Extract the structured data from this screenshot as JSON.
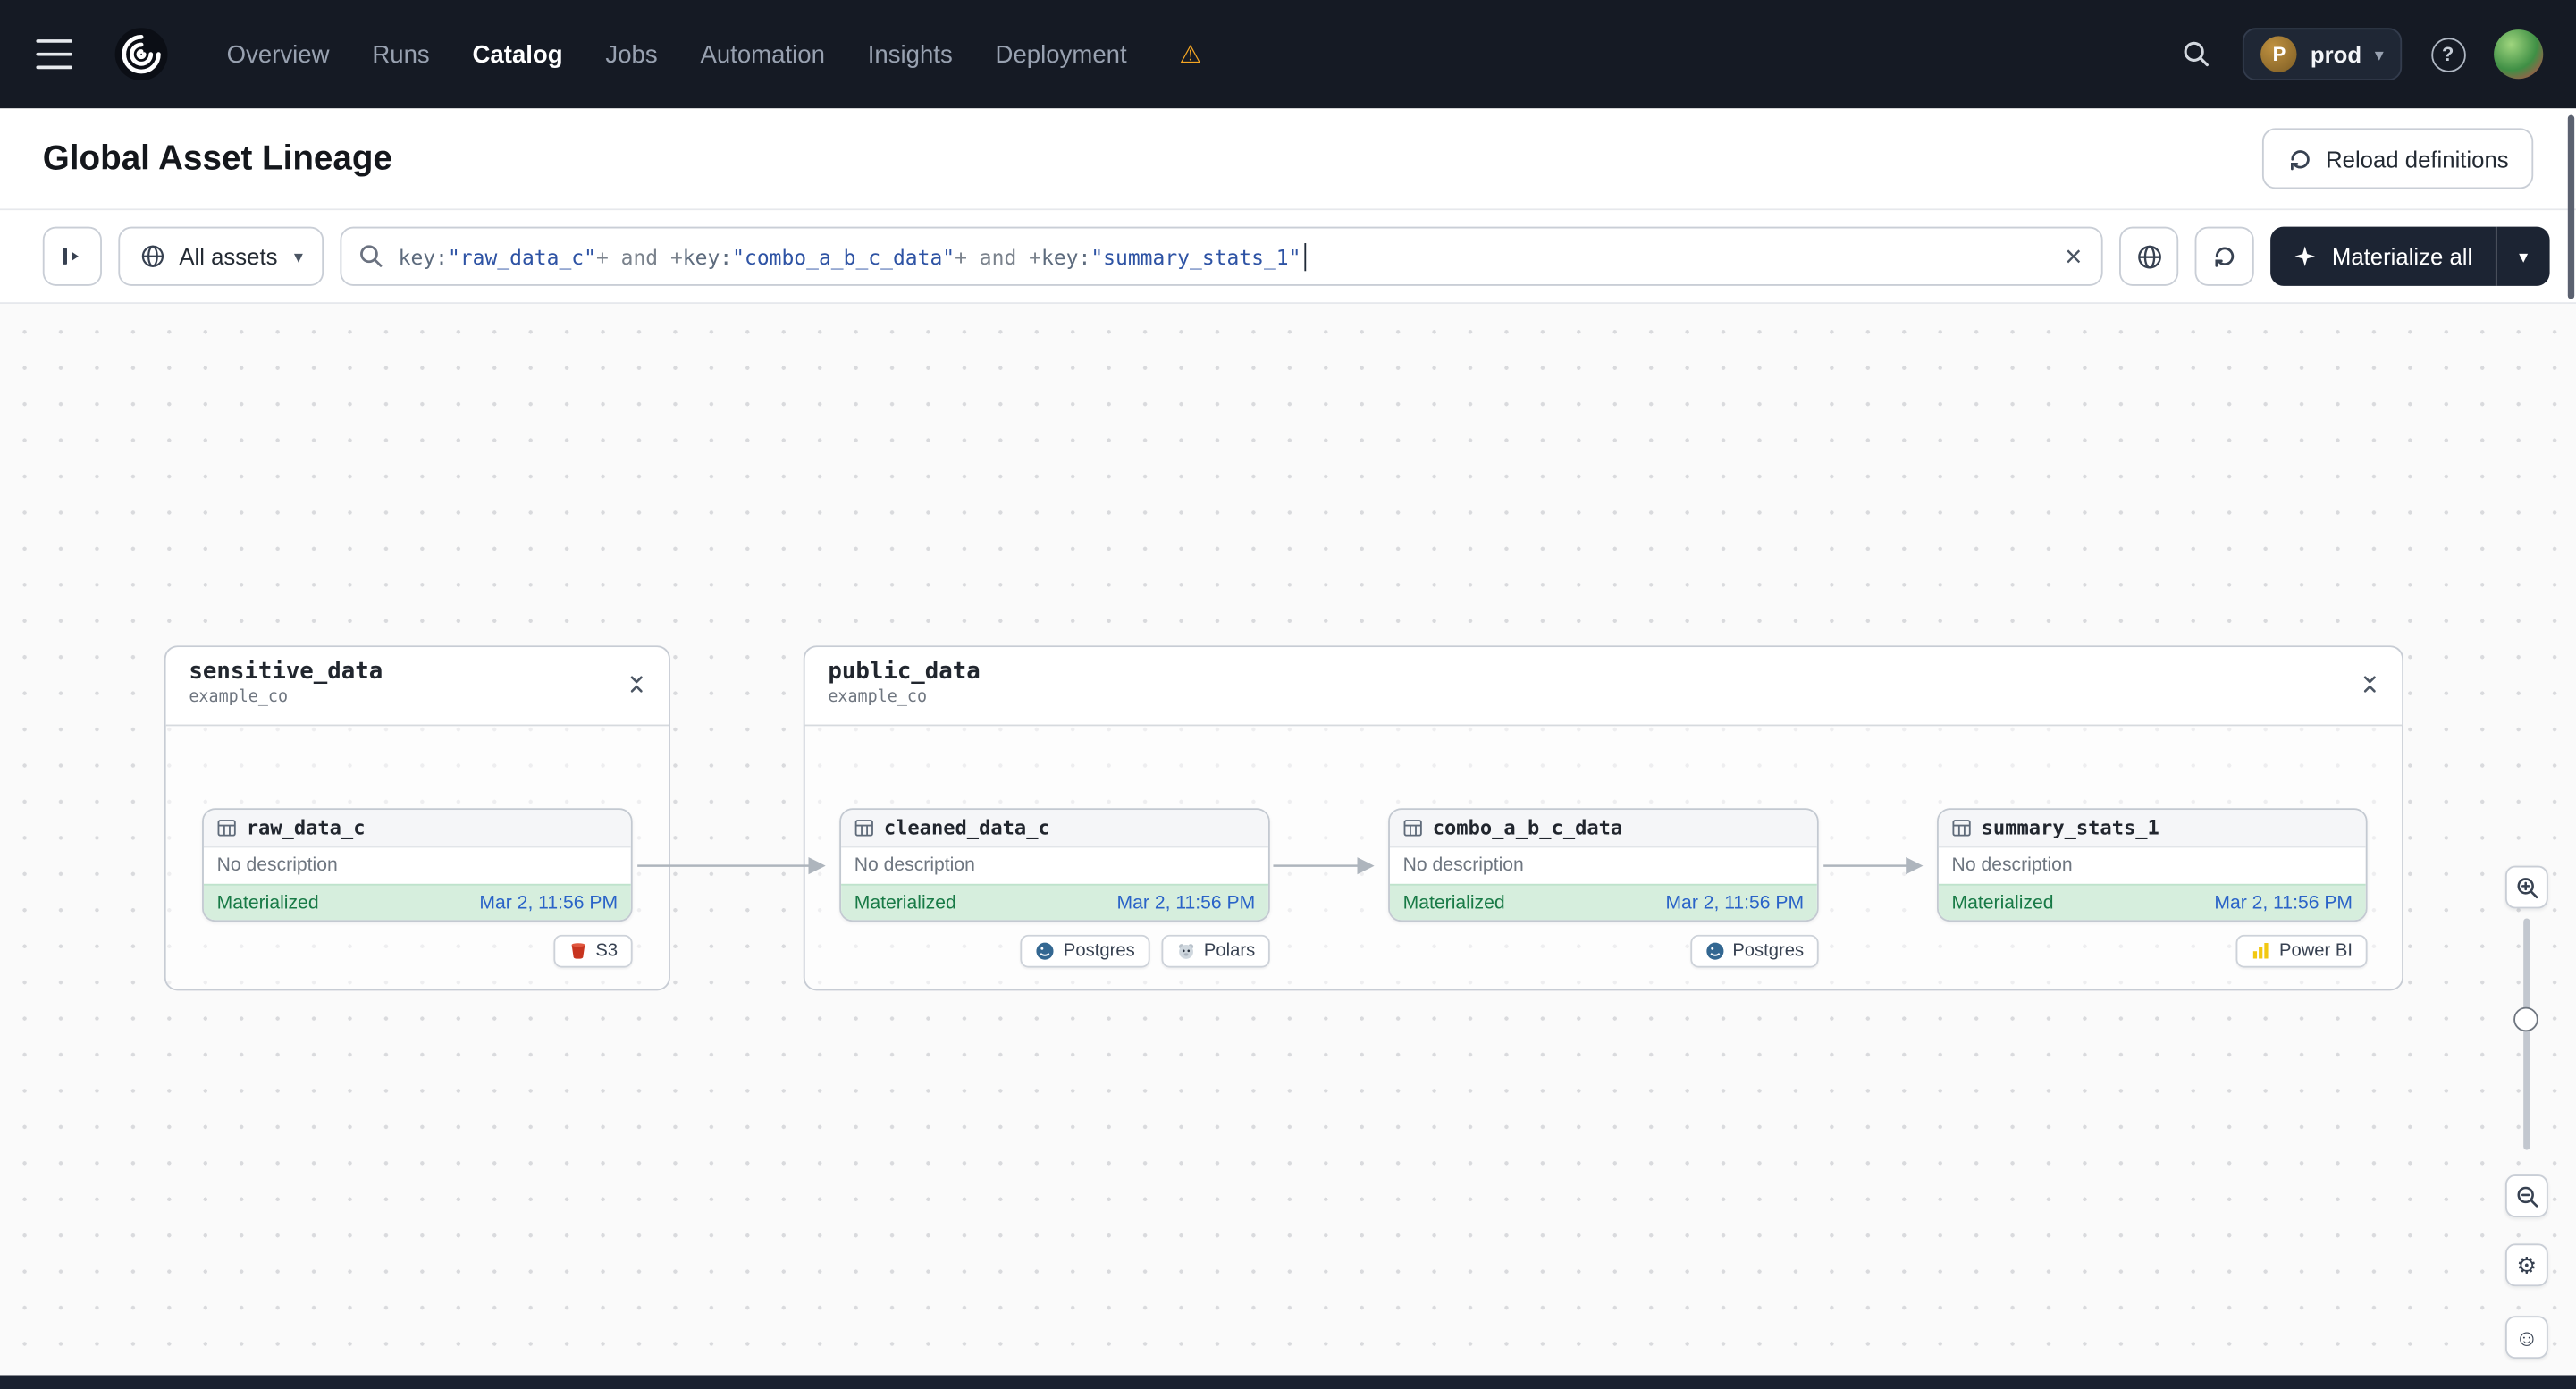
{
  "navbar": {
    "nav_items": [
      {
        "label": "Overview"
      },
      {
        "label": "Runs"
      },
      {
        "label": "Catalog"
      },
      {
        "label": "Jobs"
      },
      {
        "label": "Automation"
      },
      {
        "label": "Insights"
      },
      {
        "label": "Deployment"
      }
    ],
    "active_item": "Catalog",
    "deployment": {
      "initial": "P",
      "name": "prod"
    }
  },
  "page_header": {
    "title": "Global Asset Lineage",
    "reload_button_label": "Reload definitions"
  },
  "toolbar": {
    "scope_selector_label": "All assets",
    "query_segments": [
      {
        "text": "key:",
        "kind": "key"
      },
      {
        "text": "\"raw_data_c\"",
        "kind": "value"
      },
      {
        "text": "+ and +",
        "kind": "operator"
      },
      {
        "text": "key:",
        "kind": "key"
      },
      {
        "text": "\"combo_a_b_c_data\"",
        "kind": "value"
      },
      {
        "text": "+ and +",
        "kind": "operator"
      },
      {
        "text": "key:",
        "kind": "key"
      },
      {
        "text": "\"summary_stats_1\"",
        "kind": "value"
      }
    ],
    "materialize_button_label": "Materialize all"
  },
  "lineage": {
    "groups": [
      {
        "name": "sensitive_data",
        "location": "example_co"
      },
      {
        "name": "public_data",
        "location": "example_co"
      }
    ],
    "assets": [
      {
        "name": "raw_data_c",
        "description": "No description",
        "status": "Materialized",
        "materialized_at": "Mar 2, 11:56 PM",
        "tags": [
          "S3"
        ]
      },
      {
        "name": "cleaned_data_c",
        "description": "No description",
        "status": "Materialized",
        "materialized_at": "Mar 2, 11:56 PM",
        "tags": [
          "Postgres",
          "Polars"
        ]
      },
      {
        "name": "combo_a_b_c_data",
        "description": "No description",
        "status": "Materialized",
        "materialized_at": "Mar 2, 11:56 PM",
        "tags": [
          "Postgres"
        ]
      },
      {
        "name": "summary_stats_1",
        "description": "No description",
        "status": "Materialized",
        "materialized_at": "Mar 2, 11:56 PM",
        "tags": [
          "Power BI"
        ]
      }
    ]
  },
  "glyphs": {
    "gear": "⚙",
    "smiley": "☺",
    "caret_down": "▾",
    "clear": "×",
    "warning": "⚠",
    "help": "?"
  },
  "colors": {
    "navbar_bg": "#151a24",
    "materialize_button_bg": "#1c2433",
    "status_green_bg": "#d6eedd",
    "status_green_text": "#187a46",
    "link_blue": "#2a63c8",
    "warning_orange": "#f5a623"
  }
}
